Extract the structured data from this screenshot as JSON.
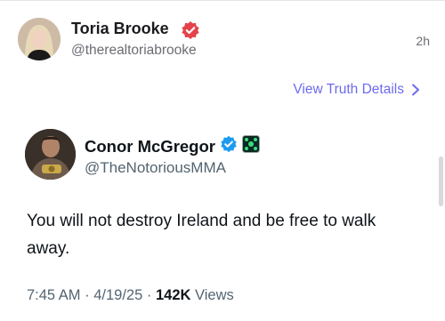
{
  "truth_post": {
    "author_name": "Toria Brooke",
    "author_handle": "@therealtoriabrooke",
    "time_ago": "2h",
    "verified_badge_icon": "truth-verified-badge-icon",
    "details_link_label": "View Truth Details"
  },
  "x_post": {
    "author_name": "Conor McGregor",
    "author_handle": "@TheNotoriousMMA",
    "verified_icon": "blue-check-verified-icon",
    "affiliate_icon": "affiliate-badge-icon",
    "text": "You will not destroy Ireland and be free to walk away.",
    "time": "7:45 AM",
    "date": "4/19/25",
    "separator": "·",
    "views_count": "142K",
    "views_label": "Views"
  },
  "colors": {
    "accent_link": "#6d6af0",
    "truth_badge": "#e4434b",
    "x_verified": "#1d9bf0",
    "secondary_text": "#536471"
  }
}
